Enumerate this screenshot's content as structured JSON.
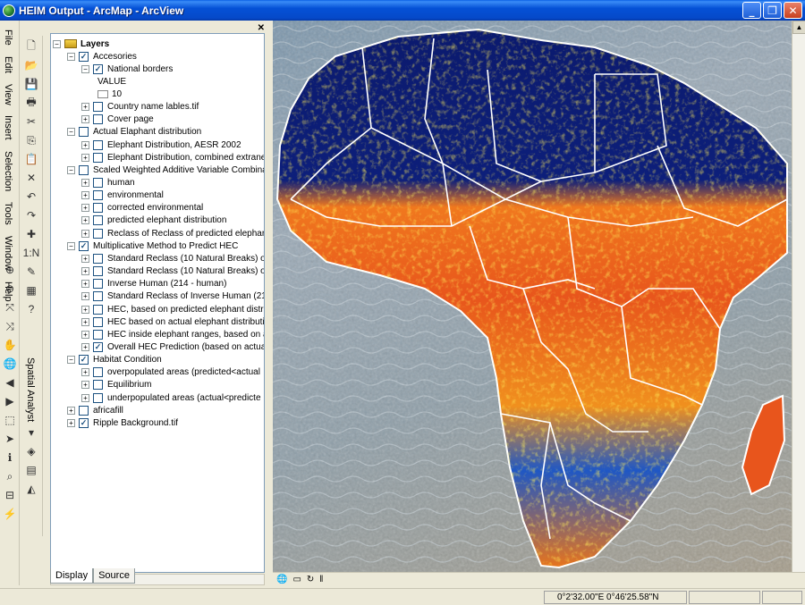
{
  "window": {
    "title": "HEIM Output - ArcMap - ArcView"
  },
  "menu": [
    "File",
    "Edit",
    "View",
    "Insert",
    "Selection",
    "Tools",
    "Window",
    "Help"
  ],
  "spatial_analyst": "Spatial Analyst",
  "toc": {
    "root": "Layers",
    "items": [
      {
        "label": "Accesories",
        "level": 1,
        "expander": "−",
        "checked": true,
        "bold": false
      },
      {
        "label": "National borders",
        "level": 2,
        "expander": "−",
        "checked": true
      },
      {
        "label": "VALUE",
        "level": 3,
        "expander": "",
        "checked": null
      },
      {
        "label": "10",
        "level": 3,
        "expander": "",
        "checked": null,
        "swatch": true
      },
      {
        "label": "Country name lables.tif",
        "level": 2,
        "expander": "+",
        "checked": false
      },
      {
        "label": "Cover page",
        "level": 2,
        "expander": "+",
        "checked": false
      },
      {
        "label": "Actual Elaphant distribution",
        "level": 1,
        "expander": "−",
        "checked": false
      },
      {
        "label": "Elephant Distribution, AESR 2002",
        "level": 2,
        "expander": "+",
        "checked": false
      },
      {
        "label": "Elephant Distribution, combined extrane",
        "level": 2,
        "expander": "+",
        "checked": false
      },
      {
        "label": "Scaled Weighted Additive Variable Combina",
        "level": 1,
        "expander": "−",
        "checked": false
      },
      {
        "label": "human",
        "level": 2,
        "expander": "+",
        "checked": false
      },
      {
        "label": "environmental",
        "level": 2,
        "expander": "+",
        "checked": false
      },
      {
        "label": "corrected environmental",
        "level": 2,
        "expander": "+",
        "checked": false
      },
      {
        "label": "predicted elephant distribution",
        "level": 2,
        "expander": "+",
        "checked": false
      },
      {
        "label": "Reclass of Reclass of predicted elephar",
        "level": 2,
        "expander": "+",
        "checked": false
      },
      {
        "label": "Multiplicative Method to Predict HEC",
        "level": 1,
        "expander": "−",
        "checked": true
      },
      {
        "label": "Standard Reclass (10 Natural Breaks) o",
        "level": 2,
        "expander": "+",
        "checked": false
      },
      {
        "label": "Standard Reclass (10 Natural Breaks) o",
        "level": 2,
        "expander": "+",
        "checked": false
      },
      {
        "label": "Inverse Human (214 - human)",
        "level": 2,
        "expander": "+",
        "checked": false
      },
      {
        "label": "Standard Reclass of Inverse Human (21",
        "level": 2,
        "expander": "+",
        "checked": false
      },
      {
        "label": "HEC, based on predicted elephant distr",
        "level": 2,
        "expander": "+",
        "checked": false
      },
      {
        "label": "HEC based on actual elephant distributi",
        "level": 2,
        "expander": "+",
        "checked": false
      },
      {
        "label": "HEC inside elephant ranges, based on a",
        "level": 2,
        "expander": "+",
        "checked": false
      },
      {
        "label": "Overall HEC Prediction (based on actua",
        "level": 2,
        "expander": "+",
        "checked": true
      },
      {
        "label": "Habitat Condition",
        "level": 1,
        "expander": "−",
        "checked": true
      },
      {
        "label": "overpopulated areas (predicted<actual",
        "level": 2,
        "expander": "+",
        "checked": false
      },
      {
        "label": "Equilibrium",
        "level": 2,
        "expander": "+",
        "checked": false
      },
      {
        "label": "underpopulated areas (actual<predicte",
        "level": 2,
        "expander": "+",
        "checked": false
      },
      {
        "label": "africafill",
        "level": 1,
        "expander": "+",
        "checked": false
      },
      {
        "label": "Ripple Background.tif",
        "level": 1,
        "expander": "+",
        "checked": true
      }
    ],
    "tabs": [
      "Display",
      "Source"
    ]
  },
  "status": {
    "coordinates": "0°2'32.00\"E  0°46'25.58\"N"
  },
  "colors": {
    "map_deep": "#0b1a6e",
    "map_blue": "#1f57c4",
    "map_cyan": "#3fb0d8",
    "map_yellow": "#f2d21c",
    "map_orange": "#f0781e",
    "map_red": "#d42a18",
    "border": "#ffffff"
  }
}
